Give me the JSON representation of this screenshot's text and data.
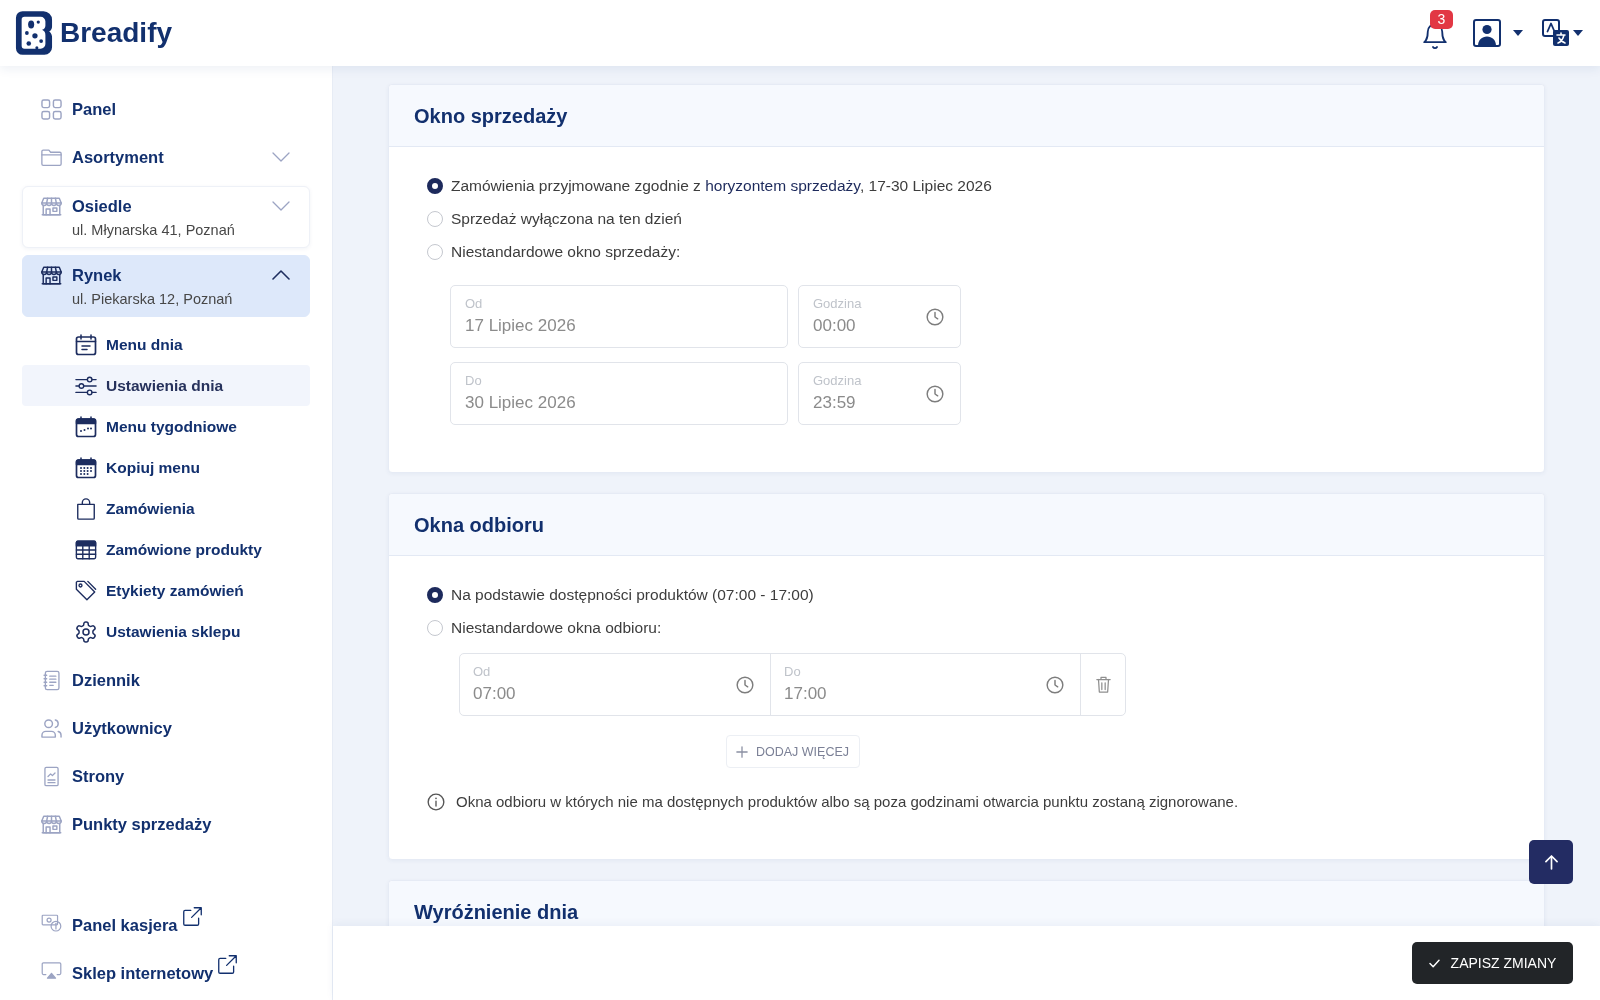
{
  "header": {
    "logo": "Breadify",
    "notification_count": "3"
  },
  "sidebar": {
    "items": [
      {
        "kind": "link",
        "label": "Panel",
        "selected": false
      },
      {
        "kind": "group",
        "label": "Asortyment",
        "expanded": false,
        "selected": false
      },
      {
        "kind": "location",
        "label": "Osiedle",
        "address": "ul. Młynarska 41, Poznań",
        "expanded": false,
        "selected": false
      },
      {
        "kind": "location",
        "label": "Rynek",
        "address": "ul. Piekarska 12, Poznań",
        "expanded": true,
        "selected": true,
        "children": [
          {
            "label": "Menu dnia",
            "selected": false
          },
          {
            "label": "Ustawienia dnia",
            "selected": true
          },
          {
            "label": "Menu tygodniowe",
            "selected": false
          },
          {
            "label": "Kopiuj menu",
            "selected": false
          },
          {
            "label": "Zamówienia",
            "selected": false
          },
          {
            "label": "Zamówione produkty",
            "selected": false
          },
          {
            "label": "Etykiety zamówień",
            "selected": false
          },
          {
            "label": "Ustawienia sklepu",
            "selected": false
          }
        ]
      },
      {
        "kind": "link",
        "label": "Dziennik",
        "selected": false
      },
      {
        "kind": "link",
        "label": "Użytkownicy",
        "selected": false
      },
      {
        "kind": "link",
        "label": "Strony",
        "selected": false
      },
      {
        "kind": "link",
        "label": "Punkty sprzedaży",
        "selected": false
      }
    ],
    "external_links": [
      {
        "label": "Panel kasjera"
      },
      {
        "label": "Sklep internetowy"
      }
    ]
  },
  "sections": [
    {
      "title": "Okno sprzedaży",
      "options": [
        {
          "label": "Zamówienia przyjmowane zgodnie z",
          "link": "horyzontem sprzedaży",
          "suffix": ", 17-30 Lipiec 2026",
          "selected": true
        },
        {
          "label": "Sprzedaż wyłączona na ten dzień",
          "selected": false
        },
        {
          "label": "Niestandardowe okno sprzedaży:",
          "selected": false
        }
      ],
      "date_ranges": [
        {
          "date_label": "Od",
          "date": "17 Lipiec 2026",
          "time_label": "Godzina",
          "time": "00:00",
          "disabled": true
        },
        {
          "date_label": "Do",
          "date": "30 Lipiec 2026",
          "time_label": "Godzina",
          "time": "23:59",
          "disabled": true
        }
      ]
    },
    {
      "title": "Okna odbioru",
      "options": [
        {
          "label": "Na podstawie dostępności produktów (07:00 - 17:00)",
          "selected": true
        },
        {
          "label": "Niestandardowe okna odbioru:",
          "selected": false
        }
      ],
      "time_windows": [
        {
          "from_label": "Od",
          "from": "07:00",
          "to_label": "Do",
          "to": "17:00",
          "disabled": true
        }
      ],
      "add_button": "DODAJ WIĘCEJ",
      "note": "Okna odbioru w których nie ma dostępnych produktów albo są poza godzinami otwarcia punktu zostaną zignorowane."
    },
    {
      "title": "Wyróżnienie dnia"
    }
  ],
  "save_button": "ZAPISZ ZMIANY"
}
